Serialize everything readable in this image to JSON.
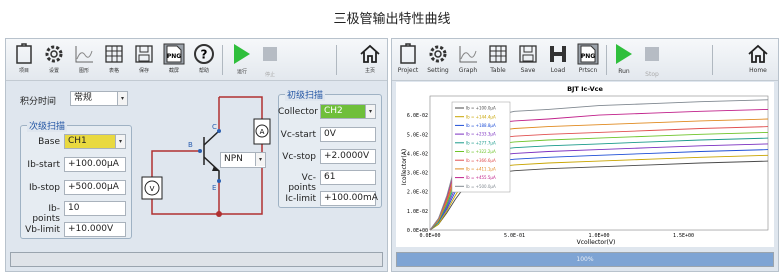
{
  "title": "三极管输出特性曲线",
  "left": {
    "toolbar": [
      {
        "name": "project",
        "label": "项目"
      },
      {
        "name": "settings",
        "label": "设置"
      },
      {
        "name": "graph",
        "label": "图形"
      },
      {
        "name": "table",
        "label": "表格"
      },
      {
        "name": "save",
        "label": "保存"
      },
      {
        "name": "screenshot",
        "label": "截屏"
      },
      {
        "name": "help",
        "label": "帮助"
      },
      {
        "name": "run",
        "label": "运行"
      },
      {
        "name": "stop",
        "label": "停止"
      },
      {
        "name": "home",
        "label": "主页"
      }
    ],
    "integration_label": "积分时间",
    "integration_value": "常规",
    "secondary": {
      "title": "次级扫描",
      "base_label": "Base",
      "base_value": "CH1",
      "ib_start_label": "Ib-start",
      "ib_start_value": "+100.00µA",
      "ib_stop_label": "Ib-stop",
      "ib_stop_value": "+500.00µA",
      "ib_points_label": "Ib-points",
      "ib_points_value": "10",
      "vb_limit_label": "Vb-limit",
      "vb_limit_value": "+10.000V"
    },
    "primary": {
      "title": "初级扫描",
      "collector_label": "Collector",
      "collector_value": "CH2",
      "vc_start_label": "Vc-start",
      "vc_start_value": "0V",
      "vc_stop_label": "Vc-stop",
      "vc_stop_value": "+2.0000V",
      "vc_points_label": "Vc-points",
      "vc_points_value": "61",
      "ic_limit_label": "Ic-limit",
      "ic_limit_value": "+100.00mA"
    },
    "circuit": {
      "npn_value": "NPN",
      "c": "C",
      "b": "B",
      "e": "E",
      "ammeter": "A",
      "voltmeter": "V"
    }
  },
  "right": {
    "toolbar": [
      {
        "name": "project",
        "label": "Project"
      },
      {
        "name": "setting",
        "label": "Setting"
      },
      {
        "name": "graph",
        "label": "Graph"
      },
      {
        "name": "table",
        "label": "Table"
      },
      {
        "name": "save",
        "label": "Save"
      },
      {
        "name": "load",
        "label": "Load"
      },
      {
        "name": "prtscn",
        "label": "Prtscn"
      },
      {
        "name": "run",
        "label": "Run"
      },
      {
        "name": "stop",
        "label": "Stop"
      },
      {
        "name": "home",
        "label": "Home"
      }
    ],
    "progress_label": "100%"
  },
  "colors": {
    "accent": "#2fbf3c",
    "base_select": "#e9d940",
    "collector_select": "#6fbf3a",
    "wire": "#b03030"
  },
  "chart_data": {
    "type": "line",
    "title": "BJT Ic-Vce",
    "xlabel": "Vcollector(V)",
    "ylabel": "Icollector(A)",
    "xlim": [
      0,
      2.0
    ],
    "ylim": [
      0,
      0.07
    ],
    "x_ticks": [
      "0.0E+00",
      "5.0E-01",
      "1.0E+00",
      "1.5E+00"
    ],
    "x_tick_values": [
      0,
      0.5,
      1.0,
      1.5
    ],
    "y_ticks": [
      "0.0E+00",
      "1.0E-02",
      "2.0E-02",
      "3.0E-02",
      "4.0E-02",
      "5.0E-02",
      "6.0E-02"
    ],
    "y_tick_values": [
      0,
      0.01,
      0.02,
      0.03,
      0.04,
      0.05,
      0.06
    ],
    "grid": true,
    "legend_position": "top-left",
    "x": [
      0,
      0.05,
      0.1,
      0.15,
      0.2,
      0.25,
      0.3,
      0.4,
      0.5,
      0.7,
      1.0,
      1.3,
      1.6,
      2.0
    ],
    "series": [
      {
        "name": "Ib = +100.0µA",
        "color": "#4a4a4a",
        "values": [
          0,
          0.003,
          0.009,
          0.016,
          0.022,
          0.026,
          0.028,
          0.03,
          0.031,
          0.032,
          0.033,
          0.034,
          0.035,
          0.036
        ]
      },
      {
        "name": "Ib = +144.4µA",
        "color": "#c8a400",
        "values": [
          0,
          0.003,
          0.01,
          0.018,
          0.025,
          0.029,
          0.031,
          0.033,
          0.034,
          0.035,
          0.036,
          0.037,
          0.038,
          0.039
        ]
      },
      {
        "name": "Ib = +188.8µA",
        "color": "#1f4fd6",
        "values": [
          0,
          0.004,
          0.011,
          0.02,
          0.028,
          0.032,
          0.034,
          0.036,
          0.037,
          0.038,
          0.039,
          0.04,
          0.041,
          0.042
        ]
      },
      {
        "name": "Ib = +233.3µA",
        "color": "#7a2fc0",
        "values": [
          0,
          0.004,
          0.012,
          0.022,
          0.03,
          0.035,
          0.037,
          0.039,
          0.04,
          0.041,
          0.042,
          0.043,
          0.044,
          0.045
        ]
      },
      {
        "name": "Ib = +277.7µA",
        "color": "#1a9a8a",
        "values": [
          0,
          0.004,
          0.013,
          0.024,
          0.033,
          0.038,
          0.04,
          0.042,
          0.043,
          0.044,
          0.045,
          0.046,
          0.047,
          0.048
        ]
      },
      {
        "name": "Ib = +322.2µA",
        "color": "#6fc42a",
        "values": [
          0,
          0.005,
          0.014,
          0.026,
          0.035,
          0.04,
          0.043,
          0.045,
          0.046,
          0.047,
          0.048,
          0.049,
          0.05,
          0.051
        ]
      },
      {
        "name": "Ib = +366.6µA",
        "color": "#e05050",
        "values": [
          0,
          0.005,
          0.015,
          0.028,
          0.038,
          0.043,
          0.046,
          0.048,
          0.049,
          0.05,
          0.051,
          0.052,
          0.053,
          0.054
        ]
      },
      {
        "name": "Ib = +411.1µA",
        "color": "#e08a20",
        "values": [
          0,
          0.005,
          0.016,
          0.03,
          0.041,
          0.047,
          0.05,
          0.052,
          0.053,
          0.054,
          0.055,
          0.056,
          0.057,
          0.058
        ]
      },
      {
        "name": "Ib = +455.5µA",
        "color": "#c0208a",
        "values": [
          0,
          0.006,
          0.017,
          0.032,
          0.044,
          0.051,
          0.054,
          0.056,
          0.057,
          0.058,
          0.06,
          0.061,
          0.062,
          0.063
        ]
      },
      {
        "name": "Ib = +500.0µA",
        "color": "#808890",
        "values": [
          0,
          0.006,
          0.018,
          0.034,
          0.047,
          0.054,
          0.058,
          0.06,
          0.062,
          0.063,
          0.065,
          0.066,
          0.067,
          0.068
        ]
      }
    ]
  }
}
